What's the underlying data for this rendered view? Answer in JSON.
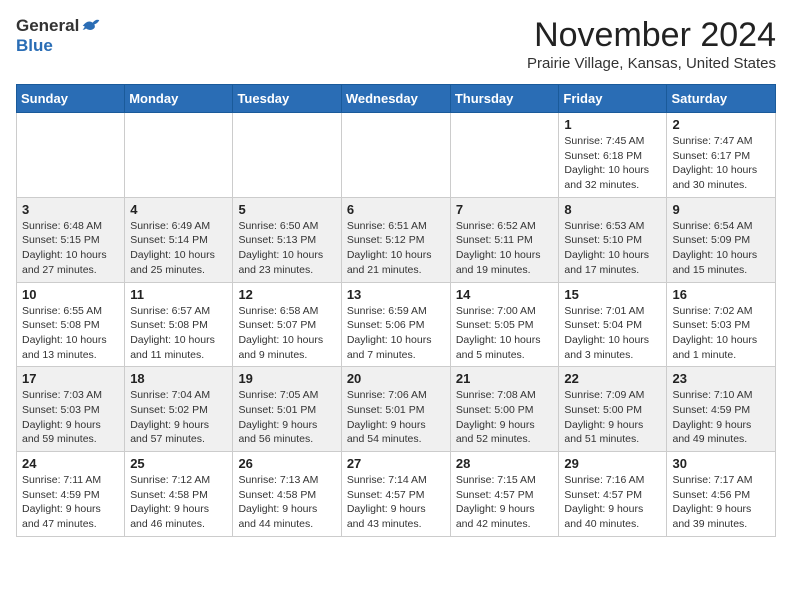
{
  "header": {
    "logo_general": "General",
    "logo_blue": "Blue",
    "month_title": "November 2024",
    "location": "Prairie Village, Kansas, United States"
  },
  "days_of_week": [
    "Sunday",
    "Monday",
    "Tuesday",
    "Wednesday",
    "Thursday",
    "Friday",
    "Saturday"
  ],
  "weeks": [
    [
      {
        "day": "",
        "info": ""
      },
      {
        "day": "",
        "info": ""
      },
      {
        "day": "",
        "info": ""
      },
      {
        "day": "",
        "info": ""
      },
      {
        "day": "",
        "info": ""
      },
      {
        "day": "1",
        "info": "Sunrise: 7:45 AM\nSunset: 6:18 PM\nDaylight: 10 hours and 32 minutes."
      },
      {
        "day": "2",
        "info": "Sunrise: 7:47 AM\nSunset: 6:17 PM\nDaylight: 10 hours and 30 minutes."
      }
    ],
    [
      {
        "day": "3",
        "info": "Sunrise: 6:48 AM\nSunset: 5:15 PM\nDaylight: 10 hours and 27 minutes."
      },
      {
        "day": "4",
        "info": "Sunrise: 6:49 AM\nSunset: 5:14 PM\nDaylight: 10 hours and 25 minutes."
      },
      {
        "day": "5",
        "info": "Sunrise: 6:50 AM\nSunset: 5:13 PM\nDaylight: 10 hours and 23 minutes."
      },
      {
        "day": "6",
        "info": "Sunrise: 6:51 AM\nSunset: 5:12 PM\nDaylight: 10 hours and 21 minutes."
      },
      {
        "day": "7",
        "info": "Sunrise: 6:52 AM\nSunset: 5:11 PM\nDaylight: 10 hours and 19 minutes."
      },
      {
        "day": "8",
        "info": "Sunrise: 6:53 AM\nSunset: 5:10 PM\nDaylight: 10 hours and 17 minutes."
      },
      {
        "day": "9",
        "info": "Sunrise: 6:54 AM\nSunset: 5:09 PM\nDaylight: 10 hours and 15 minutes."
      }
    ],
    [
      {
        "day": "10",
        "info": "Sunrise: 6:55 AM\nSunset: 5:08 PM\nDaylight: 10 hours and 13 minutes."
      },
      {
        "day": "11",
        "info": "Sunrise: 6:57 AM\nSunset: 5:08 PM\nDaylight: 10 hours and 11 minutes."
      },
      {
        "day": "12",
        "info": "Sunrise: 6:58 AM\nSunset: 5:07 PM\nDaylight: 10 hours and 9 minutes."
      },
      {
        "day": "13",
        "info": "Sunrise: 6:59 AM\nSunset: 5:06 PM\nDaylight: 10 hours and 7 minutes."
      },
      {
        "day": "14",
        "info": "Sunrise: 7:00 AM\nSunset: 5:05 PM\nDaylight: 10 hours and 5 minutes."
      },
      {
        "day": "15",
        "info": "Sunrise: 7:01 AM\nSunset: 5:04 PM\nDaylight: 10 hours and 3 minutes."
      },
      {
        "day": "16",
        "info": "Sunrise: 7:02 AM\nSunset: 5:03 PM\nDaylight: 10 hours and 1 minute."
      }
    ],
    [
      {
        "day": "17",
        "info": "Sunrise: 7:03 AM\nSunset: 5:03 PM\nDaylight: 9 hours and 59 minutes."
      },
      {
        "day": "18",
        "info": "Sunrise: 7:04 AM\nSunset: 5:02 PM\nDaylight: 9 hours and 57 minutes."
      },
      {
        "day": "19",
        "info": "Sunrise: 7:05 AM\nSunset: 5:01 PM\nDaylight: 9 hours and 56 minutes."
      },
      {
        "day": "20",
        "info": "Sunrise: 7:06 AM\nSunset: 5:01 PM\nDaylight: 9 hours and 54 minutes."
      },
      {
        "day": "21",
        "info": "Sunrise: 7:08 AM\nSunset: 5:00 PM\nDaylight: 9 hours and 52 minutes."
      },
      {
        "day": "22",
        "info": "Sunrise: 7:09 AM\nSunset: 5:00 PM\nDaylight: 9 hours and 51 minutes."
      },
      {
        "day": "23",
        "info": "Sunrise: 7:10 AM\nSunset: 4:59 PM\nDaylight: 9 hours and 49 minutes."
      }
    ],
    [
      {
        "day": "24",
        "info": "Sunrise: 7:11 AM\nSunset: 4:59 PM\nDaylight: 9 hours and 47 minutes."
      },
      {
        "day": "25",
        "info": "Sunrise: 7:12 AM\nSunset: 4:58 PM\nDaylight: 9 hours and 46 minutes."
      },
      {
        "day": "26",
        "info": "Sunrise: 7:13 AM\nSunset: 4:58 PM\nDaylight: 9 hours and 44 minutes."
      },
      {
        "day": "27",
        "info": "Sunrise: 7:14 AM\nSunset: 4:57 PM\nDaylight: 9 hours and 43 minutes."
      },
      {
        "day": "28",
        "info": "Sunrise: 7:15 AM\nSunset: 4:57 PM\nDaylight: 9 hours and 42 minutes."
      },
      {
        "day": "29",
        "info": "Sunrise: 7:16 AM\nSunset: 4:57 PM\nDaylight: 9 hours and 40 minutes."
      },
      {
        "day": "30",
        "info": "Sunrise: 7:17 AM\nSunset: 4:56 PM\nDaylight: 9 hours and 39 minutes."
      }
    ]
  ]
}
